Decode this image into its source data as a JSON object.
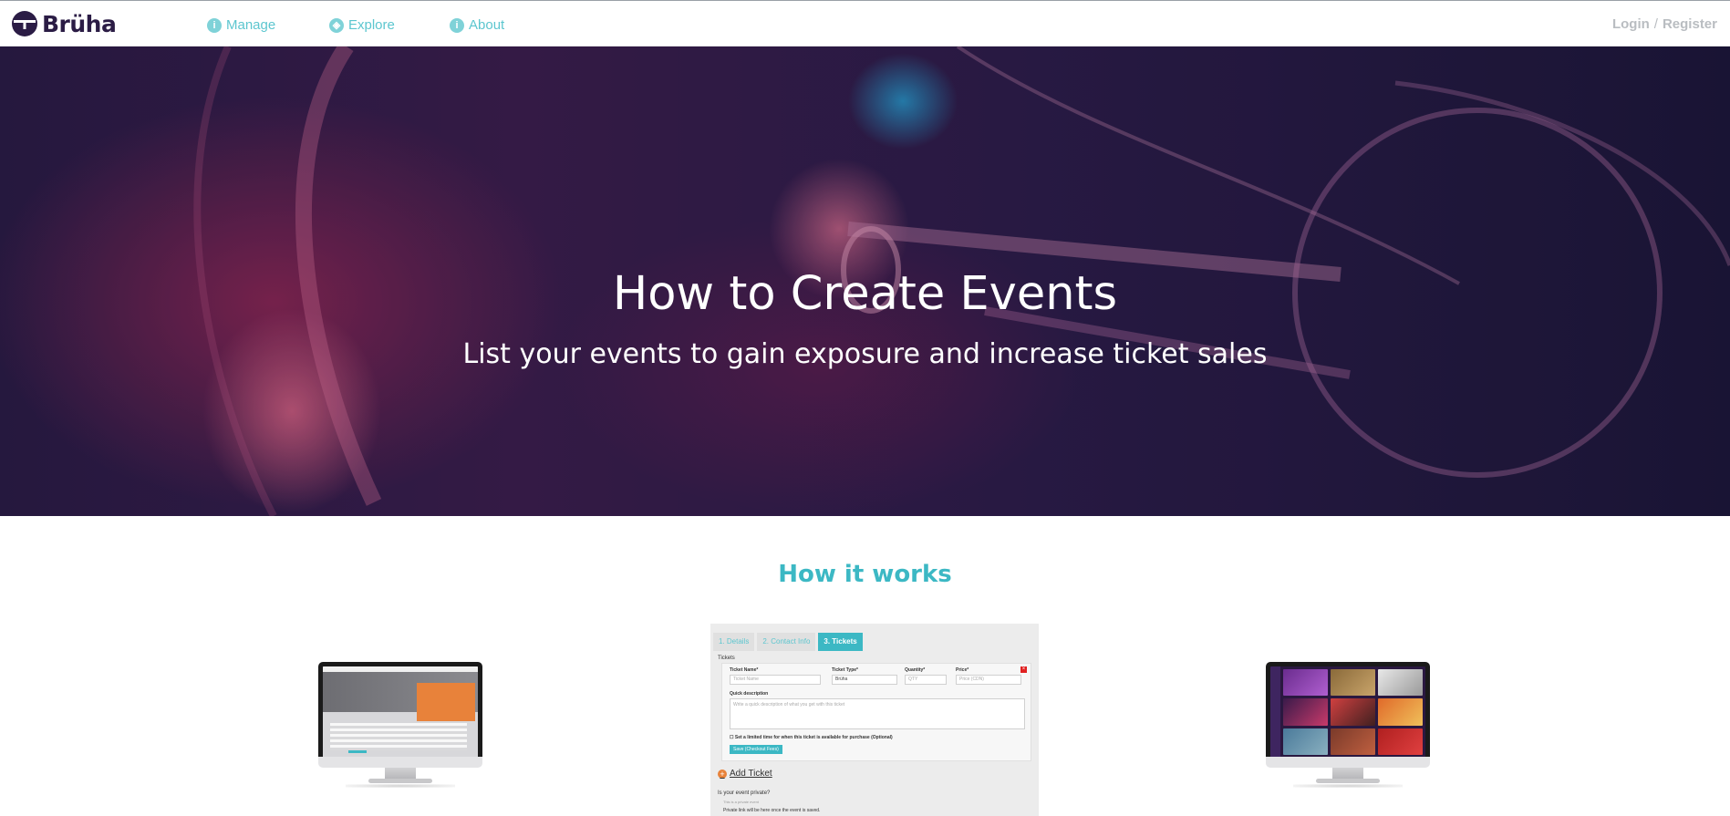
{
  "brand": {
    "name": "Brüha",
    "color": "#2b1c45"
  },
  "nav": {
    "items": [
      {
        "label": "Manage",
        "icon": "info-icon"
      },
      {
        "label": "Explore",
        "icon": "compass-icon"
      },
      {
        "label": "About",
        "icon": "info-icon"
      }
    ],
    "login": "Login",
    "separator": "/",
    "register": "Register",
    "accent": "#5cc6cf"
  },
  "hero": {
    "title": "How to Create Events",
    "subtitle": "List your events to gain exposure and increase ticket sales"
  },
  "how_it_works": {
    "title": "How it works",
    "accent": "#3cb8c4"
  },
  "form_mock": {
    "tabs": [
      "1. Details",
      "2. Contact Info",
      "3. Tickets"
    ],
    "active_tab": "3. Tickets",
    "section_label": "Tickets",
    "fields": {
      "ticket_name_label": "Ticket Name*",
      "ticket_name_placeholder": "Ticket Name",
      "ticket_type_label": "Ticket Type*",
      "ticket_type_value": "Brüha",
      "quantity_label": "Quantity*",
      "quantity_placeholder": "QTY",
      "price_label": "Price*",
      "price_placeholder": "Price (CDN)",
      "description_label": "Quick description",
      "description_placeholder": "Write a quick description of what you get with this ticket",
      "limited_time_label": "Set a limited time for when this ticket is available for purchase (Optional)",
      "save_button": "Save (Checkout Fees)",
      "add_ticket": "Add Ticket",
      "private_question": "Is your event private?",
      "private_option": "This is a private event",
      "private_note": "Private link will be here once the event is saved."
    }
  }
}
